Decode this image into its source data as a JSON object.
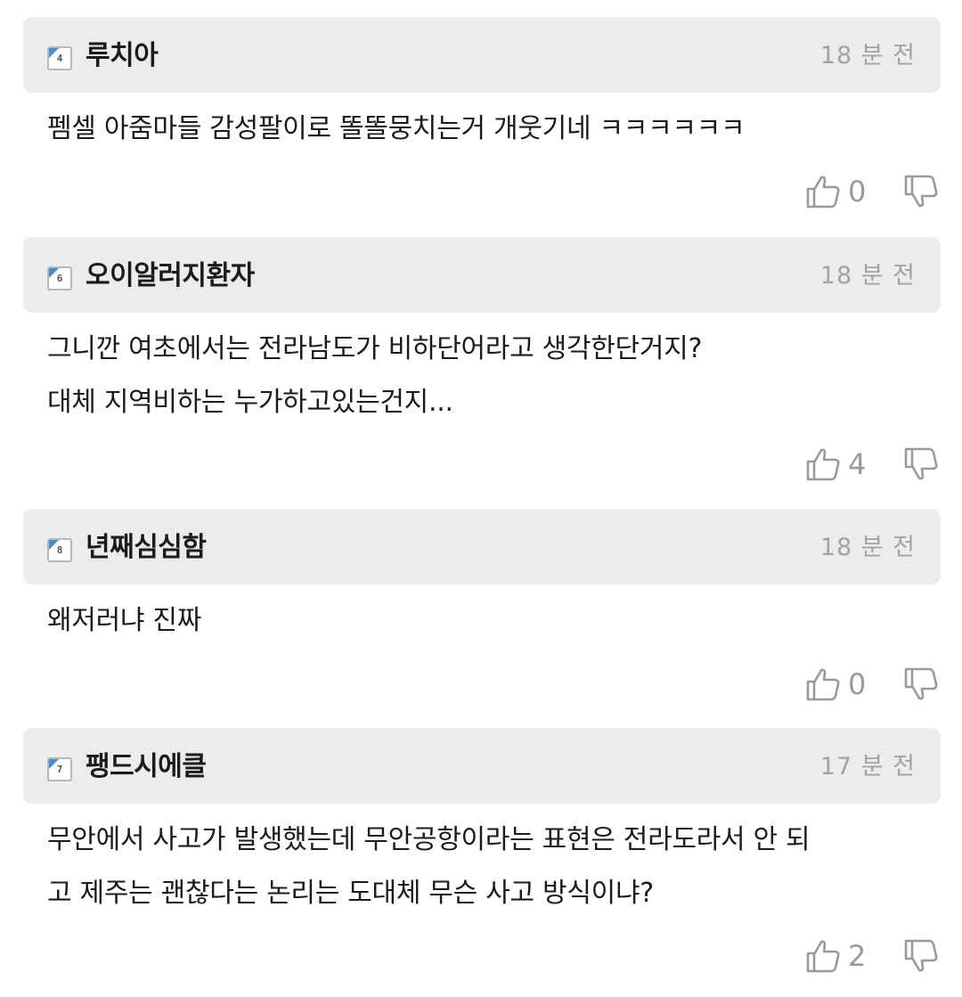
{
  "comments": [
    {
      "level": "4",
      "username": "루치아",
      "time": "18 분 전",
      "text": "펨셀 아줌마들 감성팔이로 똘똘뭉치는거 개웃기네 ㅋㅋㅋㅋㅋㅋ",
      "likes": "0",
      "like_icon": "thumbs-up-icon",
      "dislike_icon": "thumbs-down-icon"
    },
    {
      "level": "6",
      "username": "오이알러지환자",
      "time": "18 분 전",
      "text": "그니깐 여초에서는 전라남도가 비하단어라고 생각한단거지?\n대체 지역비하는 누가하고있는건지...",
      "likes": "4",
      "like_icon": "thumbs-up-icon",
      "dislike_icon": "thumbs-down-icon"
    },
    {
      "level": "8",
      "username": "년째심심함",
      "time": "18 분 전",
      "text": "왜저러냐 진짜",
      "likes": "0",
      "like_icon": "thumbs-up-icon",
      "dislike_icon": "thumbs-down-icon"
    },
    {
      "level": "7",
      "username": "팽드시에클",
      "time": "17 분 전",
      "text": "무안에서 사고가 발생했는데 무안공항이라는 표현은 전라도라서 안 되\n고 제주는 괜찮다는 논리는 도대체 무슨 사고 방식이냐?",
      "likes": "2",
      "like_icon": "thumbs-up-icon",
      "dislike_icon": "thumbs-down-icon"
    }
  ],
  "colors": {
    "header_bg": "#ececec",
    "time_text": "#a3a3a3",
    "count_text": "#9a9a9a",
    "badge_corner": "#3d8fd6"
  }
}
